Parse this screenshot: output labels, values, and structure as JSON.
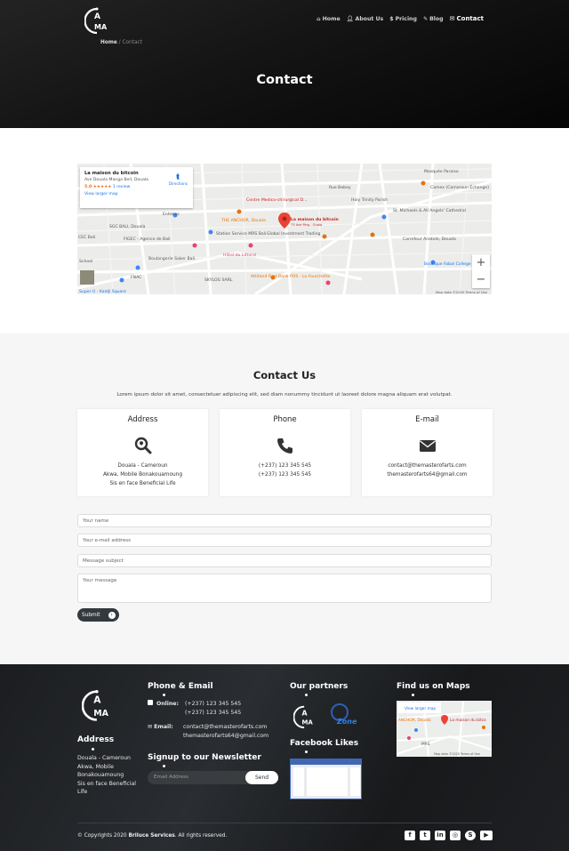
{
  "header": {
    "logo_text": "OAMA",
    "nav": [
      {
        "label": "Home",
        "icon": "home-icon"
      },
      {
        "label": "About Us",
        "icon": "user-icon"
      },
      {
        "label": "Pricing",
        "icon": "dollar-icon"
      },
      {
        "label": "Blog",
        "icon": "blog-icon"
      },
      {
        "label": "Contact",
        "icon": "envelope-icon"
      }
    ],
    "breadcrumb": {
      "home": "Home",
      "sep": "/",
      "current": "Contact"
    },
    "title": "Contact"
  },
  "map": {
    "card_title": "La maison du bitcoin",
    "card_address": "Ave Douala Manga Bell, Douala",
    "rating": "5.0 ★★★★★",
    "reviews": "1 review",
    "larger": "View larger map",
    "directions": "Directions",
    "places": [
      "Mosquée Paraiso",
      "Camex (Cameroun Échange)",
      "Holy Trinity Parish",
      "St. Michaels & All Angels' Cathedral",
      "Centre Medico-chirurgical D...",
      "Rue Bebey",
      "Entrelec",
      "SGC BALI, Douala",
      "FIGEC - Agence de Bali",
      "CEC Bali",
      "THE ANCHOR, Douala",
      "La maison du bitcoin",
      "73 Ave Mng - Ouala",
      "Station Service MRS Bali",
      "Global Investment Trading",
      "Carrefour Anatole, Douala",
      "Boulangerie Saker Bali",
      "Hôtel du Littoral",
      "Boutique Fabal College",
      "School",
      "FNAC",
      "SKYLOG SARL",
      "Attitand First Bank POS - La Fourchette",
      "Super U - Kaldji Square"
    ],
    "footer": "Map data ©2020   Terms of Use"
  },
  "contact": {
    "title": "Contact Us",
    "lead": "Lorem ipsum dolor sit amet, consectetuer adipiscing elit, sed diam nonummy tincidunt ut laoreet dolore magna aliquam erat volutpat.",
    "cards": [
      {
        "title": "Address",
        "icon": "search-location-icon",
        "lines": [
          "Douala - Cameroun",
          "Akwa, Mobile Bonakouamoung",
          "Sis en face Beneficial Life"
        ]
      },
      {
        "title": "Phone",
        "icon": "phone-icon",
        "lines": [
          "(+237) 123 345 545",
          "(+237) 123 345 545"
        ]
      },
      {
        "title": "E-mail",
        "icon": "envelope-icon",
        "lines": [
          "contact@themasterofarts.com",
          "themasterofarts64@gmail.com"
        ]
      }
    ],
    "form": {
      "name_placeholder": "Your name",
      "email_placeholder": "Your e-mail address",
      "subject_placeholder": "Message subject",
      "message_placeholder": "Your message",
      "submit": "Submit"
    }
  },
  "footer": {
    "address_title": "Address",
    "address_lines": [
      "Douala - Cameroun",
      "Akwa, Mobile",
      "Bonakouamoung",
      "Sis en face Beneficial",
      "Life"
    ],
    "phone_email_title": "Phone & Email",
    "online_label": "Online:",
    "phones": [
      "(+237) 123 345 545",
      "(+237) 123 345 545"
    ],
    "email_label": "Email:",
    "emails": [
      "contact@themasterofarts.com",
      "themasterofarts64@gmail.com"
    ],
    "newsletter_title": "Signup to our Newsletter",
    "newsletter_placeholder": "Email Address",
    "newsletter_button": "Send",
    "partners_title": "Our partners",
    "partner_2": "Zone",
    "facebook_title": "Facebook Likes",
    "maps_title": "Find us on Maps",
    "maps_thumb": {
      "larger": "View larger map",
      "place": "La maison du bitco",
      "anchor": "ANCHOR, Douala",
      "mrs": "MRS",
      "footer": "Map data ©2020   Terms of Use"
    },
    "copyright_prefix": "© Copyrights 2020 ",
    "copyright_brand": "Briluce Services",
    "copyright_suffix": ". All rights reserved.",
    "social": [
      "facebook-icon",
      "twitter-icon",
      "linkedin-icon",
      "instagram-icon",
      "skype-icon",
      "youtube-icon"
    ]
  }
}
